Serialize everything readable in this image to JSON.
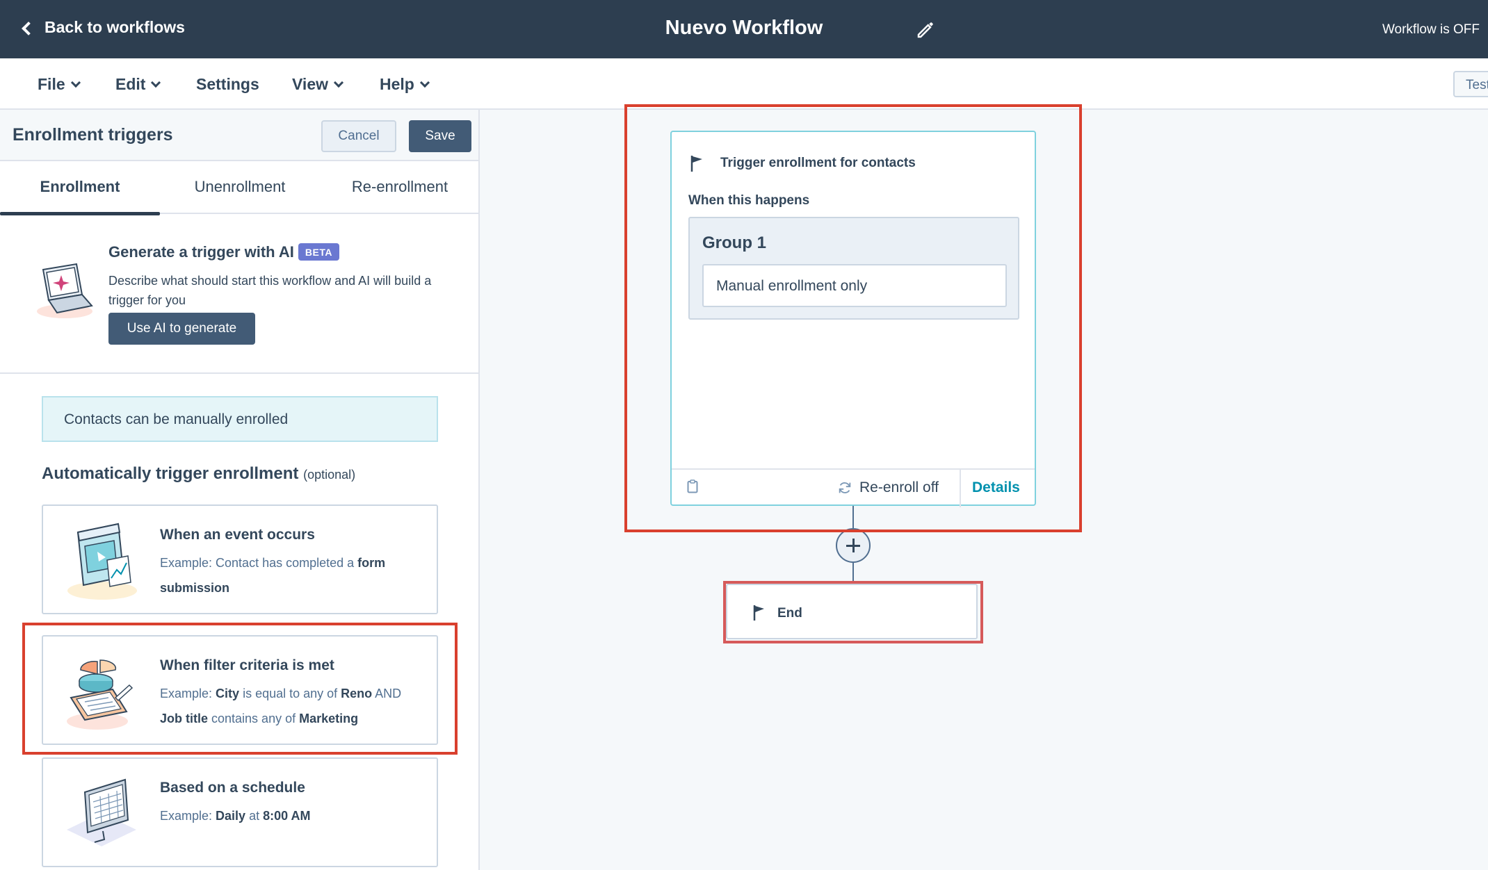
{
  "topbar": {
    "back_label": "Back to workflows",
    "title": "Nuevo Workflow",
    "status": "Workflow is OFF",
    "background": "#2d3e50"
  },
  "menu": {
    "items": [
      {
        "label": "File",
        "has_caret": true
      },
      {
        "label": "Edit",
        "has_caret": true
      },
      {
        "label": "Settings",
        "has_caret": false
      },
      {
        "label": "View",
        "has_caret": true
      },
      {
        "label": "Help",
        "has_caret": true
      }
    ],
    "test_label": "Test"
  },
  "panel": {
    "title": "Enrollment triggers",
    "cancel_label": "Cancel",
    "save_label": "Save",
    "tabs": [
      {
        "label": "Enrollment",
        "active": true
      },
      {
        "label": "Unenrollment",
        "active": false
      },
      {
        "label": "Re-enrollment",
        "active": false
      }
    ],
    "ai": {
      "title": "Generate a trigger with AI",
      "badge": "BETA",
      "description": "Describe what should start this workflow and AI will build a trigger for you",
      "button_label": "Use AI to generate",
      "icon": "laptop-sparkle-icon"
    },
    "manual_notice": "Contacts can be manually enrolled",
    "auto_title": "Automatically trigger enrollment",
    "auto_optional": "(optional)",
    "cards": [
      {
        "title": "When an event occurs",
        "icon": "browser-window-icon",
        "example": {
          "prefix": "Example: Contact has completed a ",
          "b1": "form submission"
        }
      },
      {
        "title": "When filter criteria is met",
        "icon": "pie-chart-clipboard-icon",
        "example": {
          "prefix": "Example: ",
          "b1": "City",
          "t1": " is equal to any of ",
          "b2": "Reno",
          "t2": " AND ",
          "b3": "Job title",
          "t3": " contains any of ",
          "b4": "Marketing"
        }
      },
      {
        "title": "Based on a schedule",
        "icon": "monitor-calendar-icon",
        "example": {
          "prefix": "Example: ",
          "b1": "Daily",
          "t1": " at ",
          "b2": "8:00 AM"
        }
      }
    ]
  },
  "canvas": {
    "trigger_card": {
      "title": "Trigger enrollment for contacts",
      "subtitle": "When this happens",
      "group_title": "Group 1",
      "group_item": "Manual enrollment only",
      "reenroll_label": "Re-enroll off",
      "details_label": "Details"
    },
    "end_label": "End"
  },
  "colors": {
    "accent": "#0091ae",
    "primary_button": "#425b76",
    "highlight": "#d9402e",
    "beta_badge": "#6a78d1"
  }
}
